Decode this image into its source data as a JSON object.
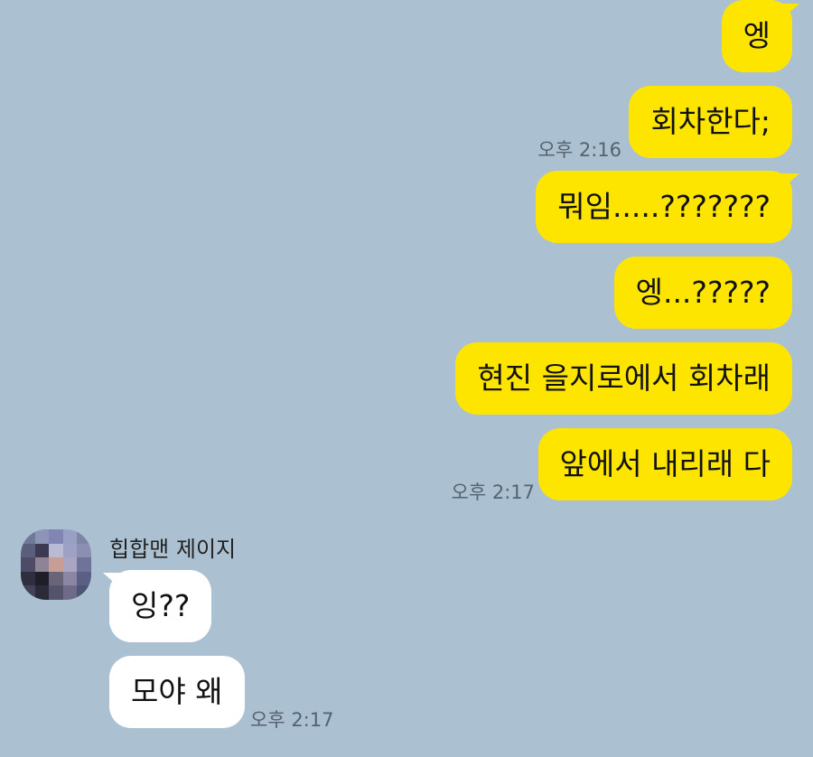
{
  "chat": {
    "sent_group_1": {
      "messages": [
        "엥",
        "회차한다;"
      ],
      "time": "오후 2:16"
    },
    "sent_group_2": {
      "messages": [
        "뭐임.....???????",
        "엥...?????",
        "현진 을지로에서 회차래",
        "앞에서 내리래 다"
      ],
      "time": "오후 2:17"
    },
    "received_group": {
      "sender_name": "힙합맨 제이지",
      "messages": [
        "잉??",
        "모야 왜"
      ],
      "time": "오후 2:17"
    }
  },
  "colors": {
    "background": "#abc1d1",
    "sent_bubble": "#fee500",
    "received_bubble": "#ffffff",
    "time_text": "#56626d"
  }
}
